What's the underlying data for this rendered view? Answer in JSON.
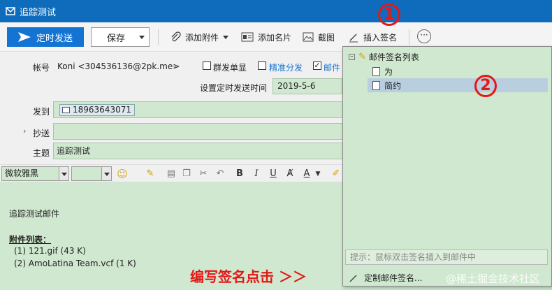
{
  "window": {
    "title": "追踪测试"
  },
  "toolbar": {
    "send_timed": "定时发送",
    "save": "保存",
    "add_attachment": "添加附件",
    "add_card": "添加名片",
    "screenshot": "截图",
    "insert_signature": "插入签名"
  },
  "form": {
    "account_label": "帐号",
    "account_value": "Koni <304536136@2pk.me>",
    "group_single": "群发单显",
    "precise_dist": "精准分发",
    "mail_track": "邮件",
    "schedule_label": "设置定时发送时间",
    "schedule_value": "2019-5-6",
    "to_label": "发到",
    "to_value": "18963643071",
    "cc_label": "抄送",
    "subject_label": "主题",
    "subject_value": "追踪测试"
  },
  "editor": {
    "font_name": "微软雅黑",
    "text_line1": "追踪测试邮件",
    "attach_title": "附件列表：",
    "attach_items": [
      "(1) 121.gif (43 K)",
      "(2) AmoLatina Team.vcf (1 K)"
    ]
  },
  "signature_popup": {
    "root_label": "邮件签名列表",
    "items": [
      "为",
      "简约"
    ],
    "hint": "提示：鼠标双击签名插入到邮件中",
    "custom": "定制邮件签名..."
  },
  "annotations": {
    "marker1": "1",
    "marker2": "2",
    "caption": "编写签名点击 ＞＞",
    "watermark": "@稀土掘金技术社区"
  },
  "colors": {
    "titlebar": "#0f6cbd",
    "accent": "#1474d4",
    "field_bg": "#cfe8cf",
    "annotation": "#e51717"
  }
}
